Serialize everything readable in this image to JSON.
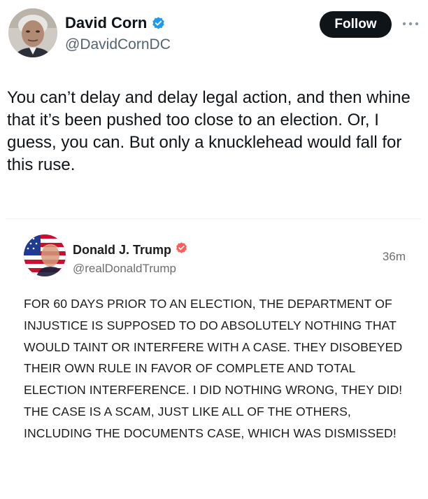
{
  "post": {
    "author": {
      "display_name": "David Corn",
      "handle": "@DavidCornDC",
      "verified": true,
      "avatar": "person-photo-avatar"
    },
    "follow_label": "Follow",
    "more_icon": "more-horizontal-icon",
    "text": "You can’t delay and delay legal action, and then whine that it’s been pushed too close to an election. Or, I guess, you can. But only a knucklehead would fall for this ruse."
  },
  "quoted_post": {
    "author": {
      "display_name": "Donald J. Trump",
      "handle": "@realDonaldTrump",
      "verified": true,
      "avatar": "flag-portrait-avatar"
    },
    "time": "36m",
    "text": "FOR 60 DAYS PRIOR TO AN ELECTION, THE DEPARTMENT OF INJUSTICE IS SUPPOSED TO DO ABSOLUTELY NOTHING THAT WOULD TAINT OR INTERFERE WITH A CASE. THEY DISOBEYED THEIR OWN RULE IN FAVOR OF COMPLETE AND TOTAL ELECTION INTERFERENCE. I DID NOTHING WRONG, THEY DID! THE CASE IS A SCAM, JUST LIKE ALL OF THE OTHERS, INCLUDING THE DOCUMENTS CASE, WHICH WAS DISMISSED!"
  },
  "colors": {
    "text_primary": "#0f1419",
    "text_secondary": "#536471",
    "verified_blue": "#1d9bf0",
    "truth_badge": "#ff5c5c",
    "follow_bg": "#0f1419"
  }
}
